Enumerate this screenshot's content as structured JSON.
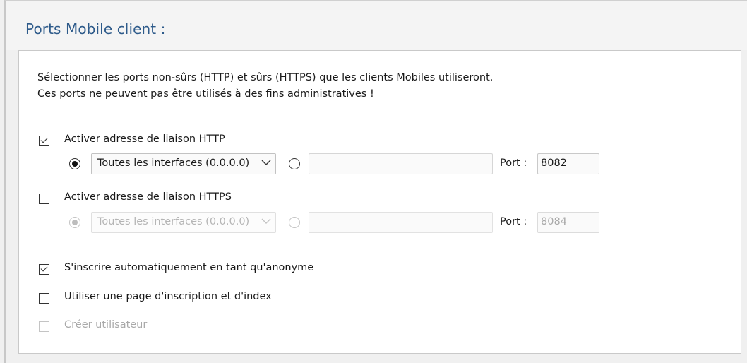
{
  "panel": {
    "title": "Ports Mobile client :"
  },
  "description": {
    "line1": "Sélectionner les ports non-sûrs (HTTP) et sûrs (HTTPS) que les clients Mobiles utiliseront.",
    "line2": "Ces ports ne peuvent pas être utilisés à des fins administratives !"
  },
  "http": {
    "enable_label": "Activer adresse de liaison HTTP",
    "enabled": true,
    "interface_value": "Toutes les interfaces (0.0.0.0)",
    "custom_address_value": "",
    "port_label": "Port :",
    "port_value": "8082"
  },
  "https": {
    "enable_label": "Activer adresse de liaison HTTPS",
    "enabled": false,
    "interface_value": "Toutes les interfaces (0.0.0.0)",
    "custom_address_value": "",
    "port_label": "Port :",
    "port_value": "8084"
  },
  "options": {
    "auto_anonymous_label": "S'inscrire automatiquement en tant qu'anonyme",
    "auto_anonymous_checked": true,
    "login_index_page_label": "Utiliser une page d'inscription et d'index",
    "login_index_page_checked": false,
    "create_user_label": "Créer utilisateur",
    "create_user_checked": false
  },
  "icons": {
    "check": "checkmark-icon",
    "dropdown_arrow": "chevron-down-icon"
  },
  "colors": {
    "title": "#2d5a8a",
    "disabled_text": "#a9a9a9",
    "content_bg": "#ffffff",
    "panel_bg": "#f0f0f0"
  }
}
